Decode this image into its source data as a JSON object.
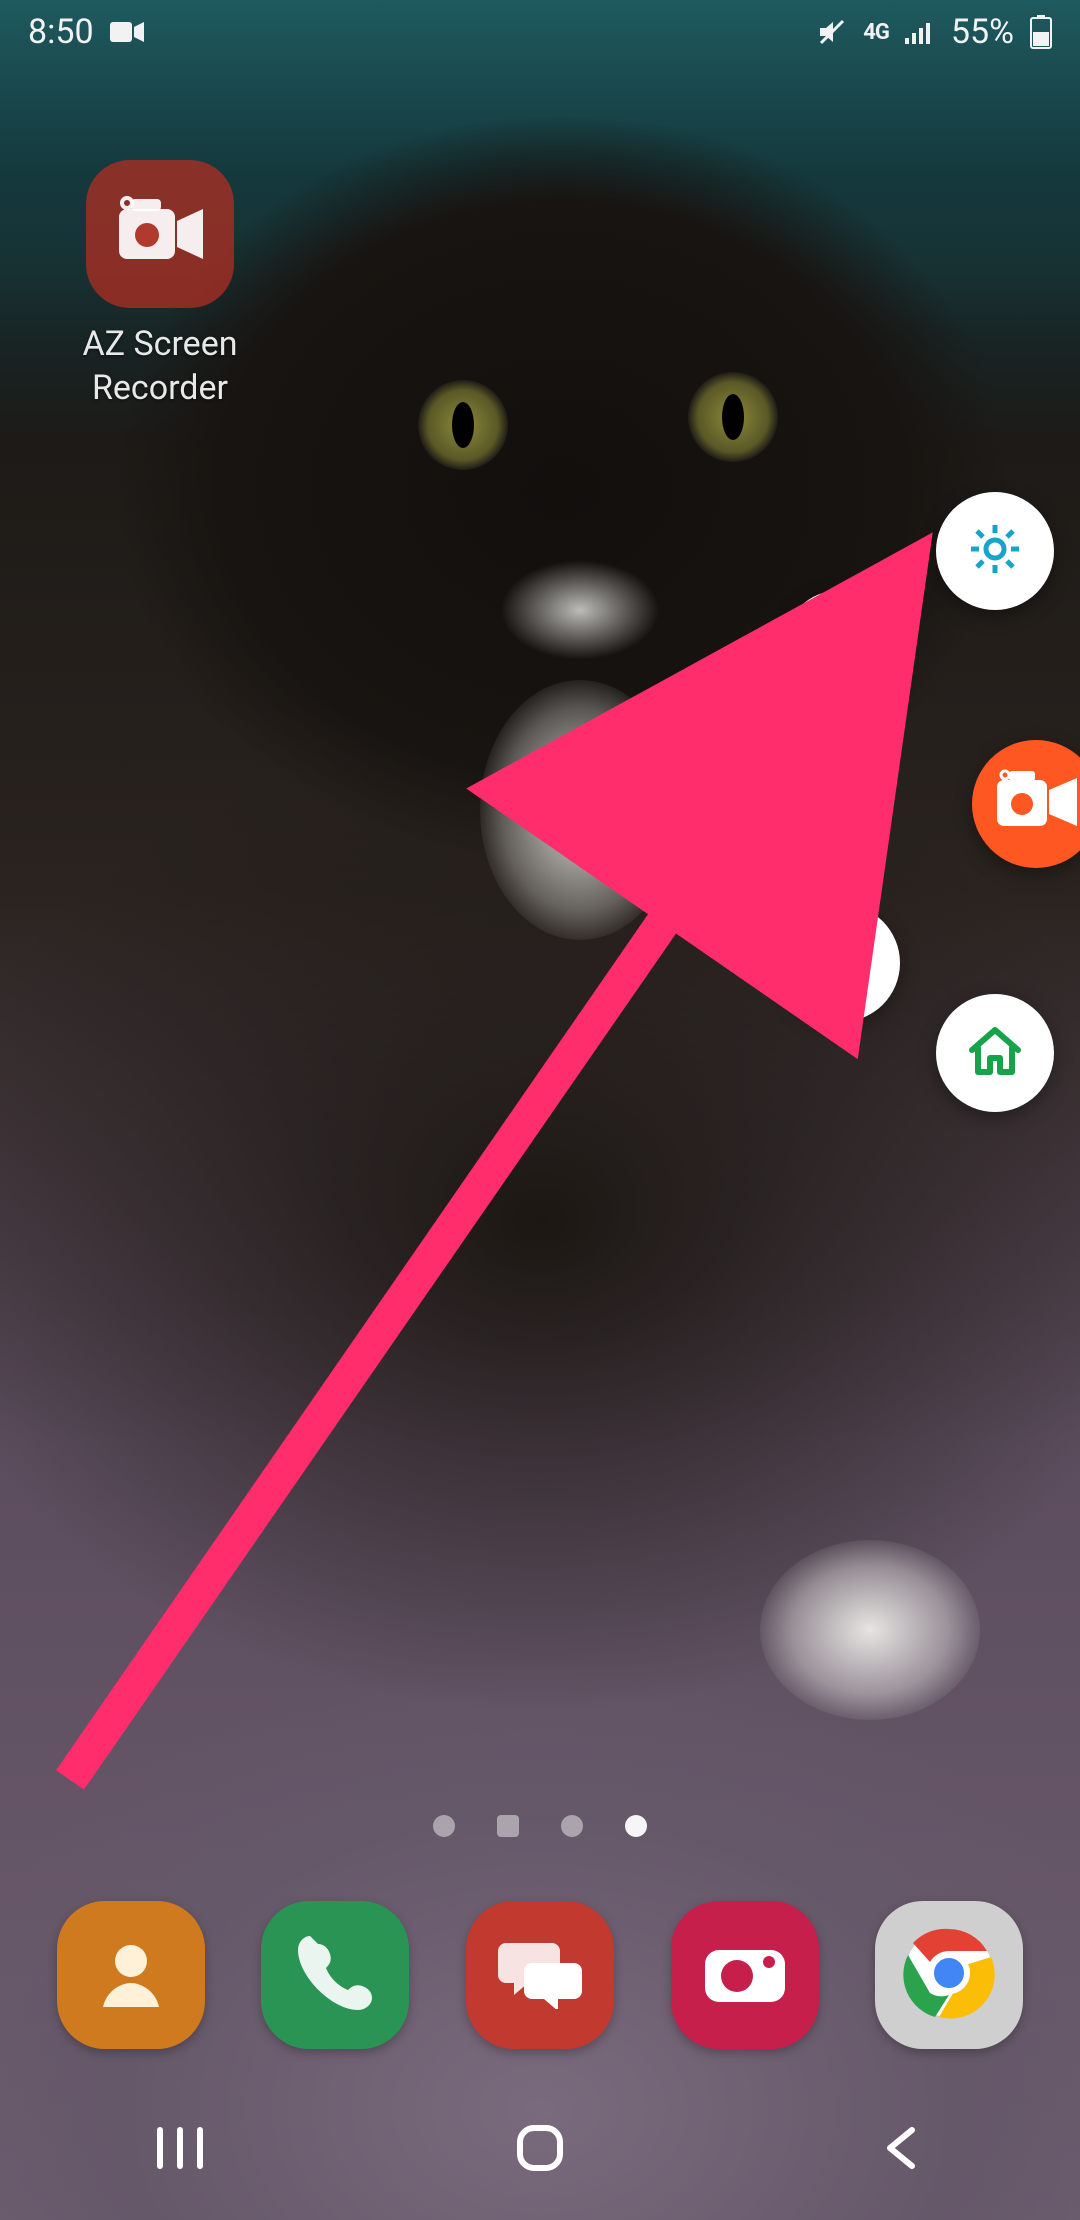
{
  "status_bar": {
    "time": "8:50",
    "battery_text": "55%",
    "network_label": "4G"
  },
  "home": {
    "app_shortcut": {
      "label": "AZ Screen\nRecorder"
    }
  },
  "radial_menu": {
    "main": "az-recorder",
    "settings": "settings",
    "screenshot": "screenshot",
    "record": "record-video",
    "live": "go-live",
    "home": "toolbox-home"
  },
  "annotation": {
    "type": "arrow",
    "color": "#ff2d6b",
    "target": "record-video"
  },
  "page_indicator": {
    "count": 4,
    "active_index": 3
  },
  "dock": {
    "apps": [
      "contacts",
      "phone",
      "messages",
      "camera",
      "chrome"
    ]
  },
  "colors": {
    "accent_orange": "#ff5722",
    "arrow": "#ff2d6b",
    "fab_bg": "#ffffff"
  }
}
